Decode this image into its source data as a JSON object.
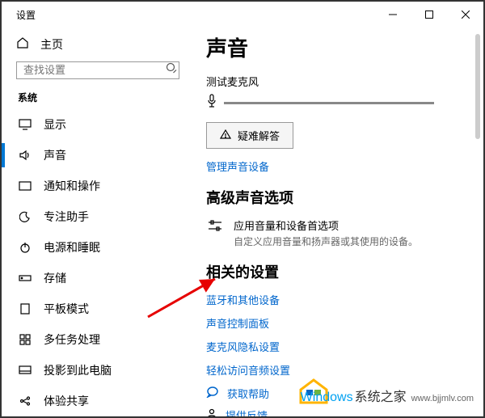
{
  "window": {
    "title": "设置"
  },
  "sidebar": {
    "home": "主页",
    "search_placeholder": "查找设置",
    "section": "系统",
    "items": [
      {
        "label": "显示"
      },
      {
        "label": "声音"
      },
      {
        "label": "通知和操作"
      },
      {
        "label": "专注助手"
      },
      {
        "label": "电源和睡眠"
      },
      {
        "label": "存储"
      },
      {
        "label": "平板模式"
      },
      {
        "label": "多任务处理"
      },
      {
        "label": "投影到此电脑"
      },
      {
        "label": "体验共享"
      }
    ]
  },
  "content": {
    "title": "声音",
    "mic_test": "测试麦克风",
    "troubleshoot": "疑难解答",
    "manage_devices": "管理声音设备",
    "advanced_heading": "高级声音选项",
    "app_volume_title": "应用音量和设备首选项",
    "app_volume_desc": "自定义应用音量和扬声器或其使用的设备。",
    "related_heading": "相关的设置",
    "link_bluetooth": "蓝牙和其他设备",
    "link_control_panel": "声音控制面板",
    "link_mic_privacy": "麦克风隐私设置",
    "link_ease_access": "轻松访问音频设置",
    "help": "获取帮助",
    "feedback": "提供反馈"
  },
  "watermark": {
    "brand": "Windows",
    "tail": "系统之家",
    "url": "www.bjjmlv.com"
  }
}
